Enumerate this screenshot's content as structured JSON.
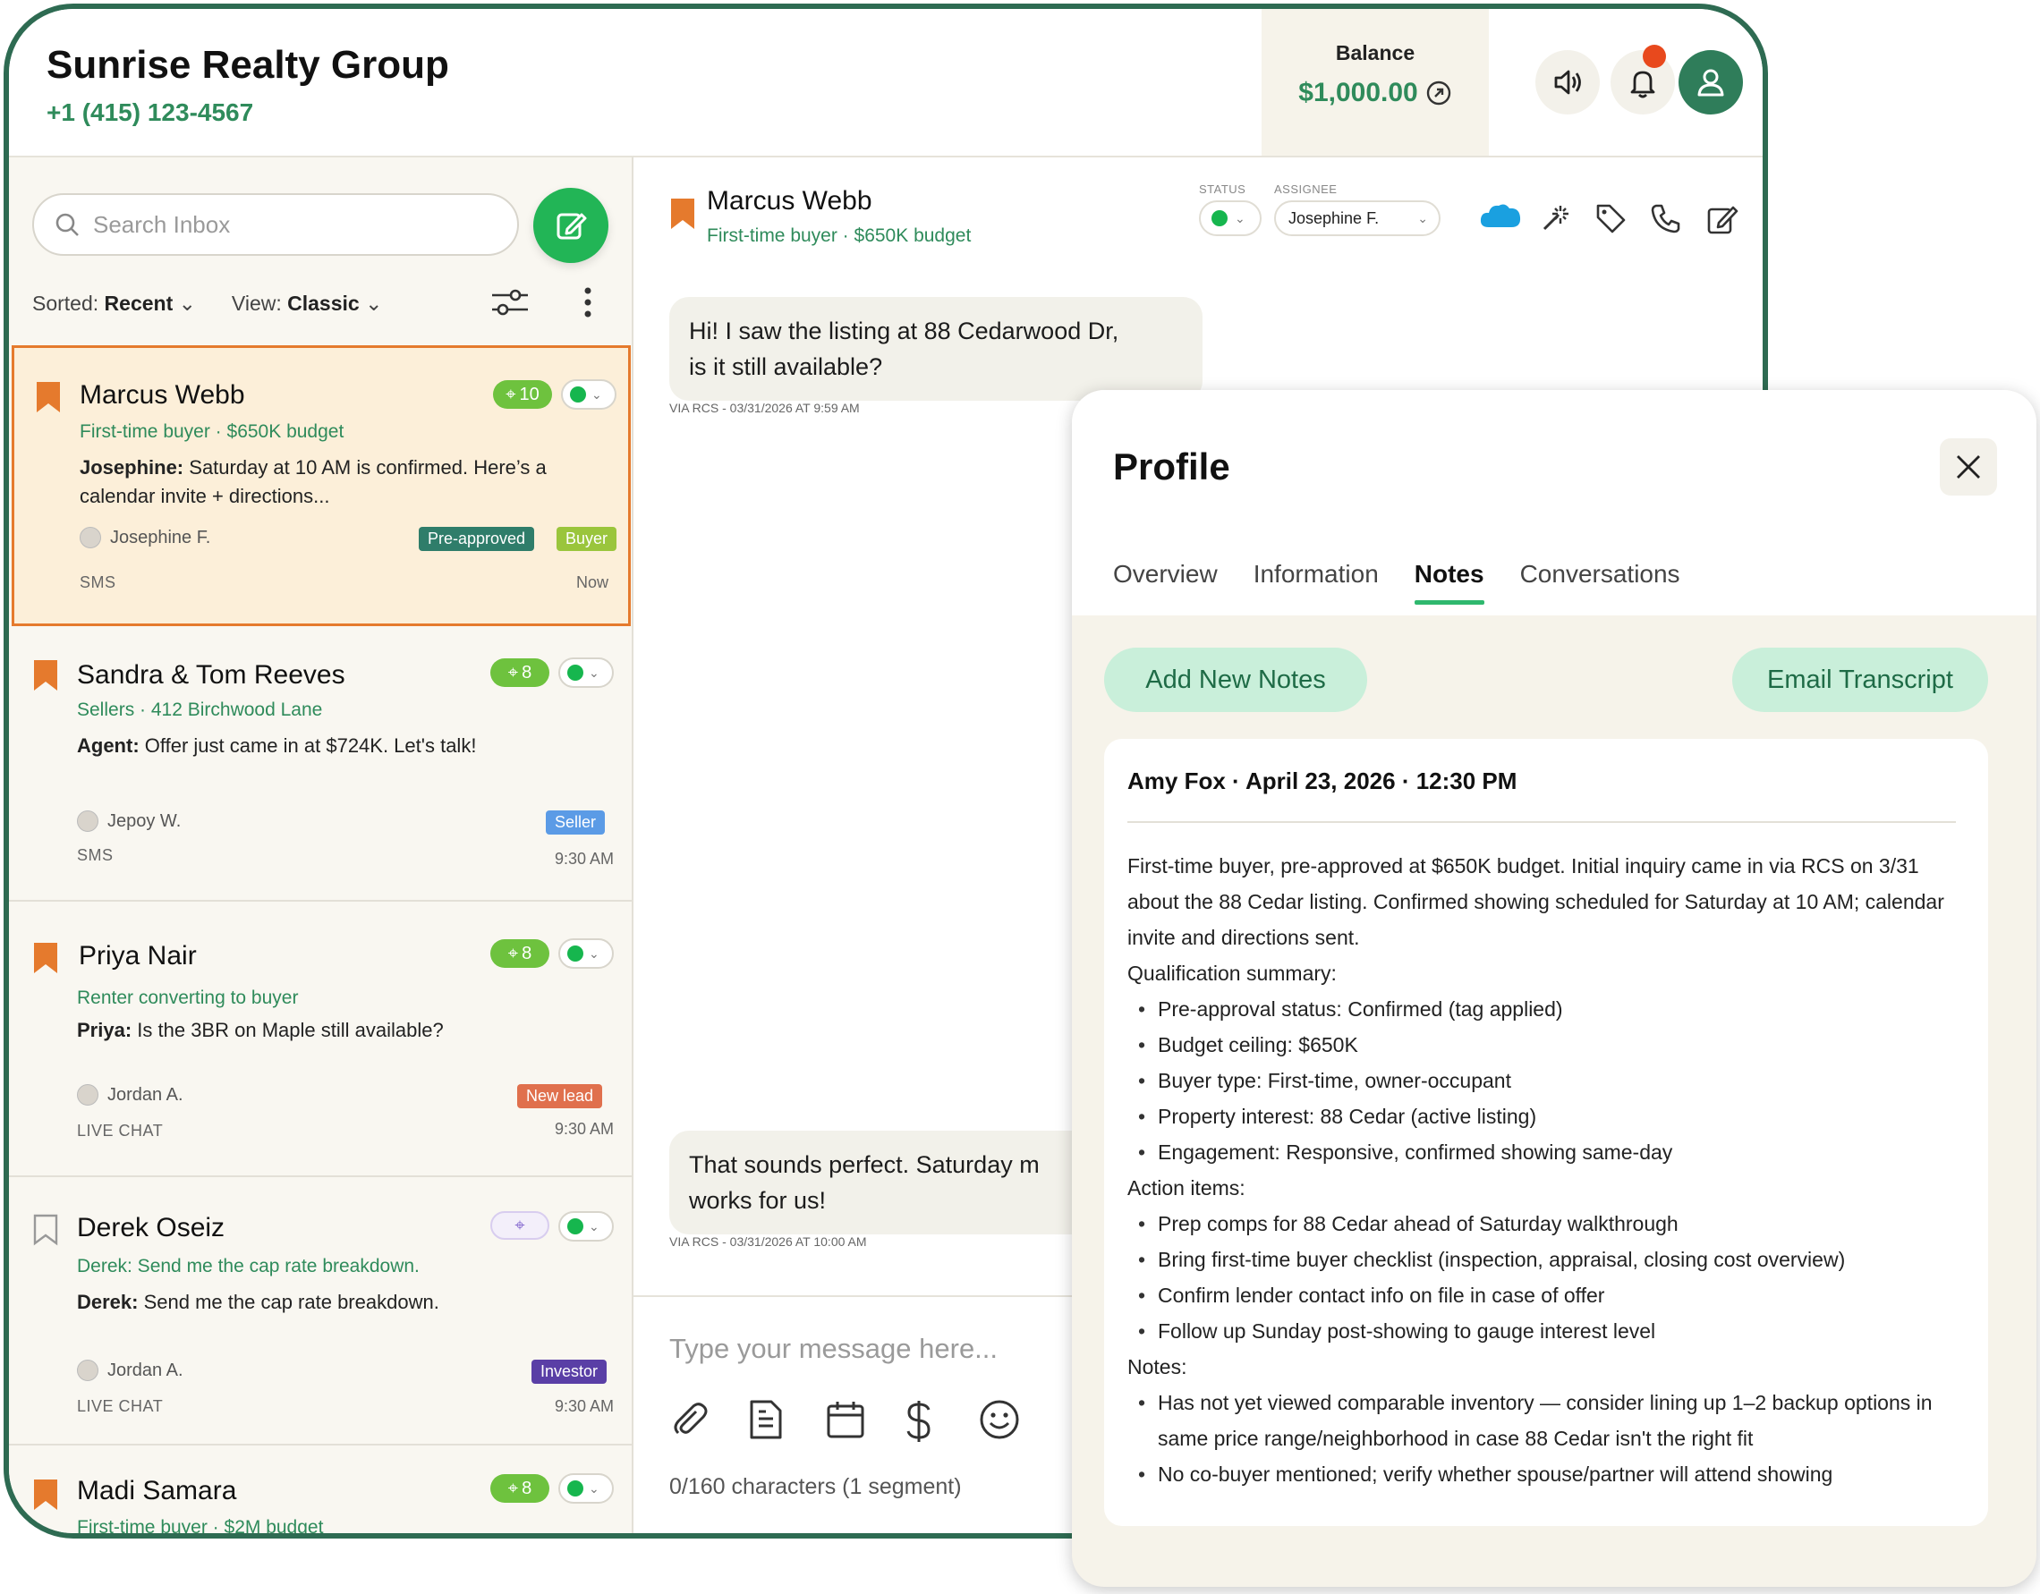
{
  "header": {
    "company": "Sunrise Realty Group",
    "phone": "+1 (415) 123-4567",
    "balance_label": "Balance",
    "balance_value": "$1,000.00"
  },
  "inbox": {
    "search_placeholder": "Search Inbox",
    "sorted_label": "Sorted:",
    "sorted_value": "Recent",
    "view_label": "View:",
    "view_value": "Classic",
    "conversations": [
      {
        "name": "Marcus Webb",
        "sub": "First-time buyer · $650K budget",
        "sender": "Josephine:",
        "message": "Saturday at 10 AM is confirmed. Here’s a calendar invite + directions...",
        "agent": "Josephine F.",
        "channel": "SMS",
        "time": "Now",
        "count": "10",
        "tags": [
          {
            "label": "Pre-approved",
            "color": "#2f7d6a"
          },
          {
            "label": "Buyer",
            "color": "#9ac53c"
          }
        ]
      },
      {
        "name": "Sandra & Tom Reeves",
        "sub": "Sellers · 412 Birchwood Lane",
        "sender": "Agent:",
        "message": "Offer just came in at $724K. Let's talk!",
        "agent": "Jepoy W.",
        "channel": "SMS",
        "time": "9:30 AM",
        "count": "8",
        "tags": [
          {
            "label": "Seller",
            "color": "#5b9be6"
          }
        ]
      },
      {
        "name": "Priya Nair",
        "sub": "Renter converting to buyer",
        "sender": "Priya:",
        "message": "Is the 3BR on Maple still available?",
        "agent": "Jordan A.",
        "channel": "LIVE CHAT",
        "time": "9:30 AM",
        "count": "8",
        "tags": [
          {
            "label": "New lead",
            "color": "#e0704d"
          }
        ]
      },
      {
        "name": "Derek Oseiz",
        "sub": "Derek: Send me the cap rate breakdown.",
        "sender": "Derek:",
        "message": "Send me the cap rate breakdown.",
        "agent": "Jordan A.",
        "channel": "LIVE CHAT",
        "time": "9:30 AM",
        "count": "",
        "tags": [
          {
            "label": "Investor",
            "color": "#5a3fa6"
          }
        ]
      },
      {
        "name": "Madi Samara",
        "sub": "First-time buyer · $2M budget",
        "count": "8"
      }
    ]
  },
  "conversation": {
    "name": "Marcus Webb",
    "sub": "First-time buyer · $650K budget",
    "status_label": "STATUS",
    "assignee_label": "ASSIGNEE",
    "assignee": "Josephine F.",
    "messages": [
      {
        "text_line1": "Hi! I saw the listing at 88 Cedarwood Dr,",
        "text_line2": "is it still available?",
        "meta": "VIA RCS - 03/31/2026 AT 9:59 AM"
      },
      {
        "text_line1": "That sounds perfect. Saturday m",
        "text_line2": "works for us!",
        "meta": "VIA RCS - 03/31/2026 AT 10:00 AM"
      }
    ],
    "composer_placeholder": "Type your message here...",
    "char_count": "0/160 characters  (1 segment)"
  },
  "profile": {
    "title": "Profile",
    "tabs": [
      "Overview",
      "Information",
      "Notes",
      "Conversations"
    ],
    "active_tab": "Notes",
    "add_notes_label": "Add New Notes",
    "email_transcript_label": "Email Transcript",
    "note": {
      "header": "Amy Fox · April 23, 2026 · 12:30 PM",
      "intro": "First-time buyer, pre-approved at $650K budget. Initial inquiry came in via RCS on 3/31 about the 88 Cedar listing. Confirmed showing scheduled for Saturday at 10 AM; calendar invite and directions sent.",
      "qual_title": "Qualification summary:",
      "qual_items": [
        "Pre-approval status: Confirmed (tag applied)",
        "Budget ceiling: $650K",
        "Buyer type: First-time, owner-occupant",
        "Property interest: 88 Cedar (active listing)",
        "Engagement: Responsive, confirmed showing same-day"
      ],
      "action_title": "Action items:",
      "action_items": [
        "Prep comps for 88 Cedar ahead of Saturday walkthrough",
        "Bring first-time buyer checklist (inspection, appraisal, closing cost overview)",
        "Confirm lender contact info on file in case of offer",
        "Follow up Sunday post-showing to gauge interest level"
      ],
      "notes_title": "Notes:",
      "notes_items": [
        "Has not yet viewed comparable inventory — consider lining up 1–2 backup options in same price range/neighborhood in case 88 Cedar isn't the right fit",
        "No co-buyer mentioned; verify whether spouse/partner will attend showing"
      ]
    }
  },
  "colors": {
    "brand_green": "#2f8b5b",
    "frame_green": "#2e6b52",
    "accent_orange": "#e57a2d",
    "status_green": "#16b64e"
  }
}
